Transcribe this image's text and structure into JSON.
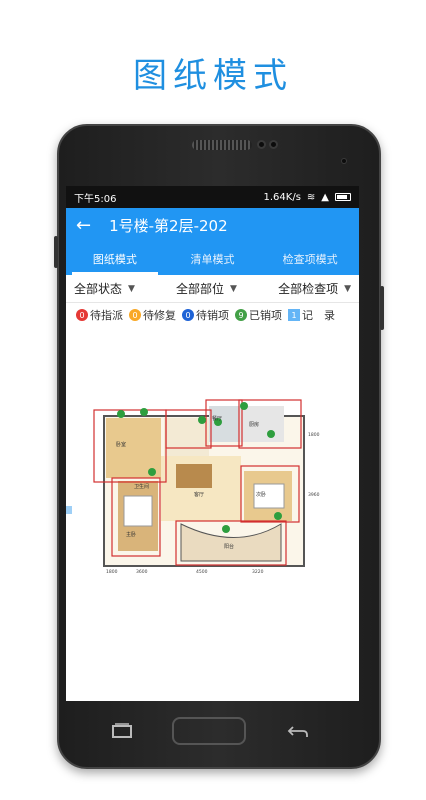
{
  "headline": "图纸模式",
  "status_bar": {
    "time": "下午5:06",
    "speed": "1.64K/s"
  },
  "app_bar": {
    "title": "1号楼-第2层-202"
  },
  "tabs": [
    {
      "label": "图纸模式",
      "active": true
    },
    {
      "label": "清单模式",
      "active": false
    },
    {
      "label": "检查项模式",
      "active": false
    }
  ],
  "filters": [
    {
      "label": "全部状态"
    },
    {
      "label": "全部部位"
    },
    {
      "label": "全部检查项"
    }
  ],
  "legend": [
    {
      "count": "0",
      "label": "待指派",
      "color": "#e53935"
    },
    {
      "count": "0",
      "label": "待修复",
      "color": "#f9a825"
    },
    {
      "count": "0",
      "label": "待销项",
      "color": "#1e63d6"
    },
    {
      "count": "9",
      "label": "已销项",
      "color": "#43a047"
    }
  ],
  "record": {
    "count": "1",
    "label": "记　录"
  },
  "floorplan": {
    "rooms": [
      "卧室",
      "厨房",
      "餐厅",
      "客厅",
      "卫生间",
      "主卧",
      "阳台",
      "次卧"
    ],
    "dimensions": [
      "1800",
      "3600",
      "4500",
      "3220",
      "1800",
      "3960"
    ]
  }
}
